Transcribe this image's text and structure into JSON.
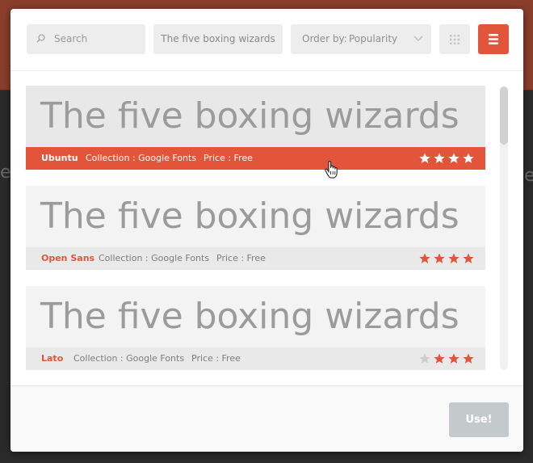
{
  "background": {
    "left_glyph": "e",
    "right_glyph": "e"
  },
  "toolbar": {
    "search_placeholder": "Search",
    "preview_text": "The five boxing wizards",
    "order_label": "Order by:",
    "order_value": "Popularity"
  },
  "fonts": [
    {
      "name": "Ubuntu",
      "collection": "Collection : Google Fonts",
      "price": "Price : Free",
      "preview": "The five boxing wizards",
      "rating": 4,
      "active": true
    },
    {
      "name": "Open Sans",
      "collection": "Collection : Google Fonts",
      "price": "Price : Free",
      "preview": "The five boxing wizards",
      "rating": 4,
      "active": false
    },
    {
      "name": "Lato",
      "collection": "Collection : Google Fonts",
      "price": "Price : Free",
      "preview": "The five boxing wizards",
      "rating": 3,
      "active": false
    }
  ],
  "footer": {
    "use_label": "Use!"
  },
  "colors": {
    "accent": "#e2553b",
    "star_off": "#cccccc",
    "disabled": "#c4c9cc"
  }
}
